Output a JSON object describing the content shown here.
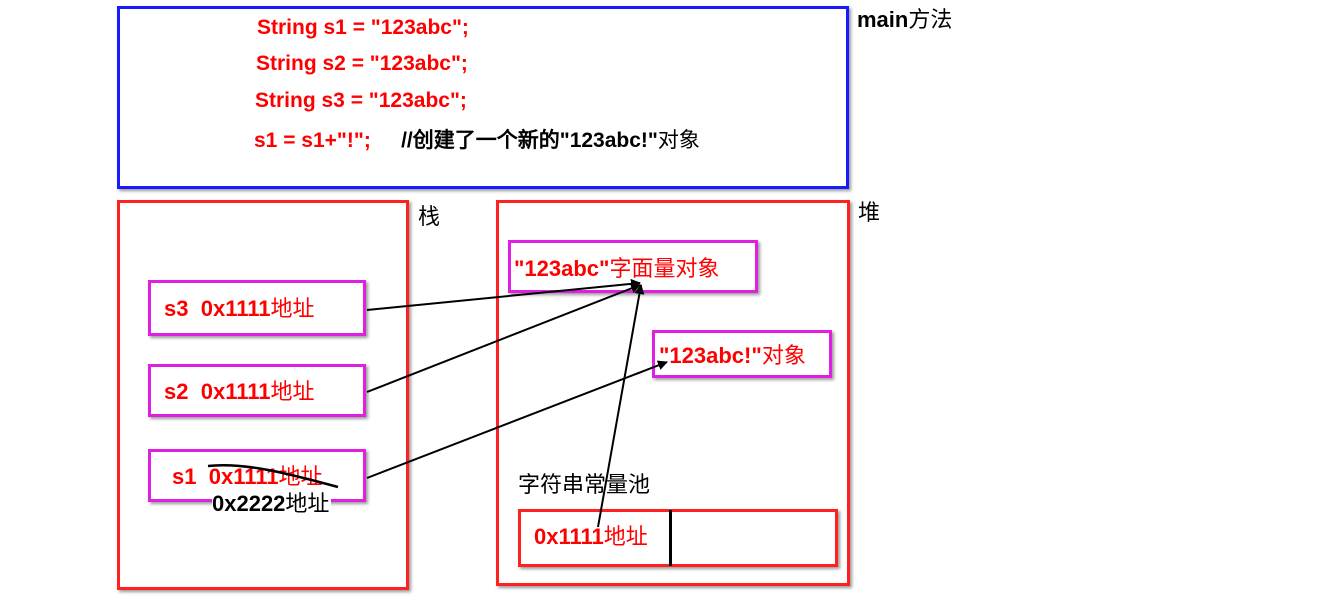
{
  "code": {
    "line1": "String s1 = \"123abc\";",
    "line2": "String s2 = \"123abc\";",
    "line3": "String s3 = \"123abc\";",
    "line4_code": "s1 = s1+\"!\";",
    "line4_comment_prefix": "//创建了一个新的",
    "line4_comment_literal": "\"123abc!\"",
    "line4_comment_suffix": "对象"
  },
  "labels": {
    "main_method_en": "main",
    "main_method_zh": "方法",
    "stack": "栈",
    "heap": "堆",
    "string_pool": "字符串常量池"
  },
  "stack_items": {
    "s3": {
      "var": "s3",
      "addr": "0x1111",
      "suffix": "地址"
    },
    "s2": {
      "var": "s2",
      "addr": "0x1111",
      "suffix": "地址"
    },
    "s1": {
      "var": "s1",
      "addr": "0x1111",
      "suffix": "地址",
      "new_addr": "0x2222",
      "new_suffix": "地址"
    }
  },
  "heap_items": {
    "literal_en": "\"123abc\"",
    "literal_zh": "字面量对象",
    "new_en": "\"123abc!\"",
    "new_zh": "对象"
  },
  "pool": {
    "addr": "0x1111",
    "suffix": "地址"
  },
  "colors": {
    "code_border": "#1a1aff",
    "area_border": "#ff2020",
    "item_border": "#e020e0",
    "text_red": "#ff0000"
  }
}
